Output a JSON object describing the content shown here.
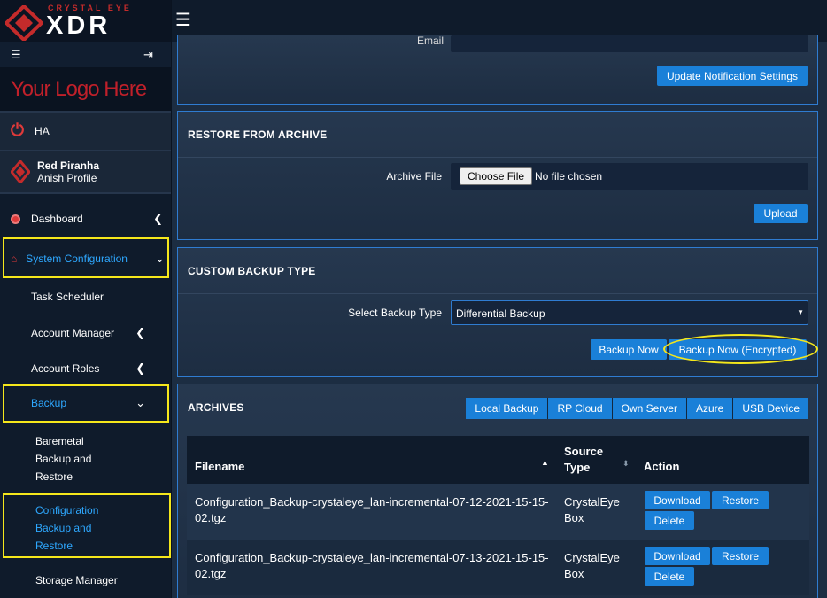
{
  "brand": {
    "top": "CRYSTAL EYE",
    "main": "XDR"
  },
  "sidebar": {
    "logo_text": "Your Logo Here",
    "ha_label": "HA",
    "profile": {
      "name": "Red Piranha",
      "sub": "Anish Profile"
    },
    "menu": {
      "dashboard": "Dashboard",
      "system_configuration": "System Configuration",
      "task_scheduler": "Task Scheduler",
      "account_manager": "Account Manager",
      "account_roles": "Account Roles",
      "backup": "Backup",
      "baremetal_1": "Baremetal",
      "baremetal_2": "Backup and",
      "baremetal_3": "Restore",
      "config_1": "Configuration",
      "config_2": "Backup and",
      "config_3": "Restore",
      "storage_manager": "Storage Manager"
    }
  },
  "notification": {
    "email_label": "Email",
    "update_button": "Update Notification Settings"
  },
  "restore": {
    "title": "RESTORE FROM ARCHIVE",
    "archive_label": "Archive File",
    "choose_button": "Choose File",
    "no_file": "No file chosen",
    "upload_button": "Upload"
  },
  "custom_backup": {
    "title": "CUSTOM BACKUP TYPE",
    "select_label": "Select Backup Type",
    "select_value": "Differential Backup",
    "backup_now": "Backup Now",
    "backup_now_encrypted": "Backup Now (Encrypted)"
  },
  "archives": {
    "title": "ARCHIVES",
    "tabs": [
      "Local Backup",
      "RP Cloud",
      "Own Server",
      "Azure",
      "USB Device"
    ],
    "columns": {
      "filename": "Filename",
      "source_1": "Source",
      "source_2": "Type",
      "action": "Action"
    },
    "rows": [
      {
        "file_1": "Configuration_Backup-crystaleye_lan-incremental-07-12-2021-15-15-",
        "file_2": "02.tgz",
        "source_1": "CrystalEye",
        "source_2": "Box",
        "download": "Download",
        "restore": "Restore",
        "delete": "Delete"
      },
      {
        "file_1": "Configuration_Backup-crystaleye_lan-incremental-07-13-2021-15-15-",
        "file_2": "02.tgz",
        "source_1": "CrystalEye",
        "source_2": "Box",
        "download": "Download",
        "restore": "Restore",
        "delete": "Delete"
      }
    ]
  },
  "colors": {
    "accent": "#1a80d8",
    "highlight": "#f5e71b",
    "brand_red": "#c42b2b",
    "active_text": "#2ea8ff"
  }
}
